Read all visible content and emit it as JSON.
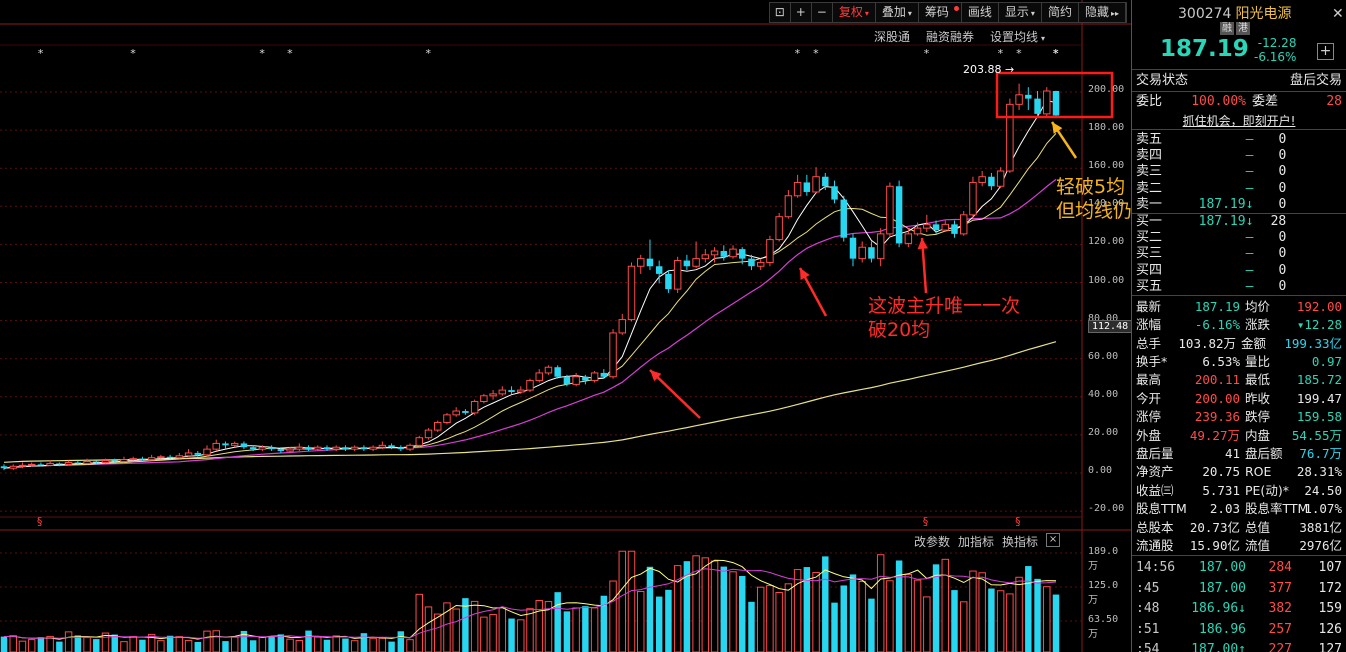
{
  "toolbar": {
    "fuquan": "复权",
    "diejia": "叠加",
    "chouma": "筹码",
    "huaxian": "画线",
    "xianshi": "显示",
    "jianyue": "简约",
    "yincang": "隐藏"
  },
  "subbar": {
    "shengutong": "深股通",
    "rongzi": "融资融券",
    "junxian": "设置均线"
  },
  "y_axis_ticks": [
    "200.00",
    "180.00",
    "160.00",
    "140.00",
    "120.00",
    "100.00",
    "80.00",
    "60.00",
    "40.00",
    "20.00",
    "0.00",
    "-20.00"
  ],
  "current_price_tag": "112.48",
  "peak_label": "203.88",
  "vol_axis_ticks": [
    "189.0万",
    "125.0万",
    "63.50万"
  ],
  "vol_toolbar": {
    "gaicanshu": "改参数",
    "jiazhibiao": "加指标",
    "huanzhibiao": "换指标",
    "close": "×"
  },
  "annotations": {
    "five_ma_line1": "轻破5均",
    "five_ma_line2": "但均线仍发散",
    "twenty_ma_line1": "这波主升唯一一次",
    "twenty_ma_line2": "破20均"
  },
  "colors": {
    "up": "#ff4b4b",
    "down": "#29d6f0",
    "ma5": "#ffffff",
    "ma10": "#e8e07a",
    "ma20": "#d43fd4",
    "ma60": "#e6e08a",
    "annotation_red": "#ff2a2a",
    "annotation_gold": "#f5b41a"
  },
  "chart_data": {
    "type": "candlestick",
    "title": "",
    "xlabel": "",
    "ylabel": "",
    "ylim": [
      -20,
      210
    ],
    "grid": true,
    "peak": 203.88,
    "candles": [
      {
        "o": 3,
        "c": 2,
        "h": 4,
        "l": 1
      },
      {
        "o": 2,
        "c": 3,
        "h": 4,
        "l": 1
      },
      {
        "o": 3,
        "c": 3.5,
        "h": 5,
        "l": 2
      },
      {
        "o": 3.5,
        "c": 4,
        "h": 5,
        "l": 3
      },
      {
        "o": 4,
        "c": 3.5,
        "h": 5,
        "l": 3
      },
      {
        "o": 3.5,
        "c": 4.5,
        "h": 6,
        "l": 3
      },
      {
        "o": 4.5,
        "c": 4,
        "h": 5,
        "l": 3
      },
      {
        "o": 4,
        "c": 5,
        "h": 6,
        "l": 3.5
      },
      {
        "o": 5,
        "c": 4.5,
        "h": 6,
        "l": 4
      },
      {
        "o": 4.5,
        "c": 5.5,
        "h": 7,
        "l": 4
      },
      {
        "o": 5.5,
        "c": 5,
        "h": 6,
        "l": 4
      },
      {
        "o": 5,
        "c": 6,
        "h": 7,
        "l": 4.5
      },
      {
        "o": 6,
        "c": 5.5,
        "h": 7,
        "l": 5
      },
      {
        "o": 5.5,
        "c": 6.5,
        "h": 8,
        "l": 5
      },
      {
        "o": 6.5,
        "c": 7,
        "h": 8,
        "l": 6
      },
      {
        "o": 7,
        "c": 6.5,
        "h": 8,
        "l": 6
      },
      {
        "o": 6.5,
        "c": 7.5,
        "h": 9,
        "l": 6
      },
      {
        "o": 7.5,
        "c": 8,
        "h": 9,
        "l": 7
      },
      {
        "o": 8,
        "c": 7.5,
        "h": 9,
        "l": 7
      },
      {
        "o": 7.5,
        "c": 8.5,
        "h": 10,
        "l": 7
      },
      {
        "o": 8.5,
        "c": 10,
        "h": 12,
        "l": 8
      },
      {
        "o": 10,
        "c": 9,
        "h": 11,
        "l": 8
      },
      {
        "o": 9,
        "c": 12,
        "h": 14,
        "l": 8
      },
      {
        "o": 12,
        "c": 15,
        "h": 17,
        "l": 11
      },
      {
        "o": 15,
        "c": 14,
        "h": 16,
        "l": 12
      },
      {
        "o": 14,
        "c": 15,
        "h": 16,
        "l": 13
      },
      {
        "o": 15,
        "c": 13,
        "h": 16,
        "l": 12
      },
      {
        "o": 13,
        "c": 12,
        "h": 14,
        "l": 11
      },
      {
        "o": 12,
        "c": 13,
        "h": 14,
        "l": 11
      },
      {
        "o": 13,
        "c": 12,
        "h": 14,
        "l": 11
      },
      {
        "o": 12,
        "c": 11,
        "h": 13,
        "l": 10
      },
      {
        "o": 11,
        "c": 12,
        "h": 13,
        "l": 10
      },
      {
        "o": 12,
        "c": 13,
        "h": 15,
        "l": 11
      },
      {
        "o": 13,
        "c": 12,
        "h": 14,
        "l": 11
      },
      {
        "o": 12,
        "c": 13,
        "h": 14,
        "l": 11
      },
      {
        "o": 13,
        "c": 12,
        "h": 14,
        "l": 11
      },
      {
        "o": 12,
        "c": 13,
        "h": 14,
        "l": 11
      },
      {
        "o": 13,
        "c": 12,
        "h": 14,
        "l": 11
      },
      {
        "o": 12,
        "c": 13,
        "h": 14,
        "l": 11
      },
      {
        "o": 13,
        "c": 12,
        "h": 14,
        "l": 11
      },
      {
        "o": 12,
        "c": 13,
        "h": 14,
        "l": 11
      },
      {
        "o": 13,
        "c": 14,
        "h": 16,
        "l": 12
      },
      {
        "o": 14,
        "c": 13,
        "h": 15,
        "l": 12
      },
      {
        "o": 13,
        "c": 12,
        "h": 14,
        "l": 11
      },
      {
        "o": 12,
        "c": 14,
        "h": 15,
        "l": 11
      },
      {
        "o": 14,
        "c": 18,
        "h": 19,
        "l": 13
      },
      {
        "o": 18,
        "c": 22,
        "h": 23,
        "l": 17
      },
      {
        "o": 22,
        "c": 26,
        "h": 27,
        "l": 21
      },
      {
        "o": 26,
        "c": 30,
        "h": 31,
        "l": 25
      },
      {
        "o": 30,
        "c": 32,
        "h": 34,
        "l": 29
      },
      {
        "o": 32,
        "c": 31,
        "h": 33,
        "l": 30
      },
      {
        "o": 31,
        "c": 37,
        "h": 38,
        "l": 30
      },
      {
        "o": 37,
        "c": 40,
        "h": 41,
        "l": 36
      },
      {
        "o": 40,
        "c": 41,
        "h": 43,
        "l": 38
      },
      {
        "o": 41,
        "c": 43,
        "h": 45,
        "l": 40
      },
      {
        "o": 43,
        "c": 42,
        "h": 45,
        "l": 41
      },
      {
        "o": 42,
        "c": 43,
        "h": 45,
        "l": 41
      },
      {
        "o": 43,
        "c": 48,
        "h": 49,
        "l": 42
      },
      {
        "o": 48,
        "c": 52,
        "h": 54,
        "l": 47
      },
      {
        "o": 52,
        "c": 55,
        "h": 56,
        "l": 51
      },
      {
        "o": 55,
        "c": 50,
        "h": 56,
        "l": 49
      },
      {
        "o": 50,
        "c": 46,
        "h": 51,
        "l": 45
      },
      {
        "o": 46,
        "c": 50,
        "h": 52,
        "l": 45
      },
      {
        "o": 50,
        "c": 48,
        "h": 51,
        "l": 46
      },
      {
        "o": 48,
        "c": 52,
        "h": 53,
        "l": 47
      },
      {
        "o": 52,
        "c": 50,
        "h": 54,
        "l": 49
      },
      {
        "o": 50,
        "c": 73,
        "h": 75,
        "l": 49
      },
      {
        "o": 73,
        "c": 80,
        "h": 83,
        "l": 72
      },
      {
        "o": 80,
        "c": 108,
        "h": 110,
        "l": 79
      },
      {
        "o": 108,
        "c": 112,
        "h": 114,
        "l": 104
      },
      {
        "o": 112,
        "c": 108,
        "h": 122,
        "l": 106
      },
      {
        "o": 108,
        "c": 104,
        "h": 111,
        "l": 99
      },
      {
        "o": 104,
        "c": 96,
        "h": 106,
        "l": 94
      },
      {
        "o": 96,
        "c": 111,
        "h": 113,
        "l": 94
      },
      {
        "o": 111,
        "c": 108,
        "h": 114,
        "l": 106
      },
      {
        "o": 108,
        "c": 112,
        "h": 121,
        "l": 107
      },
      {
        "o": 112,
        "c": 114,
        "h": 117,
        "l": 110
      },
      {
        "o": 114,
        "c": 116,
        "h": 118,
        "l": 110
      },
      {
        "o": 116,
        "c": 113,
        "h": 119,
        "l": 111
      },
      {
        "o": 113,
        "c": 117,
        "h": 119,
        "l": 112
      },
      {
        "o": 117,
        "c": 112,
        "h": 118,
        "l": 109
      },
      {
        "o": 112,
        "c": 108,
        "h": 114,
        "l": 106
      },
      {
        "o": 108,
        "c": 110,
        "h": 112,
        "l": 106
      },
      {
        "o": 110,
        "c": 122,
        "h": 124,
        "l": 108
      },
      {
        "o": 122,
        "c": 134,
        "h": 136,
        "l": 121
      },
      {
        "o": 134,
        "c": 145,
        "h": 148,
        "l": 133
      },
      {
        "o": 145,
        "c": 152,
        "h": 156,
        "l": 144
      },
      {
        "o": 152,
        "c": 147,
        "h": 156,
        "l": 145
      },
      {
        "o": 147,
        "c": 155,
        "h": 160,
        "l": 146
      },
      {
        "o": 155,
        "c": 150,
        "h": 157,
        "l": 148
      },
      {
        "o": 150,
        "c": 143,
        "h": 153,
        "l": 141
      },
      {
        "o": 143,
        "c": 123,
        "h": 145,
        "l": 121
      },
      {
        "o": 123,
        "c": 112,
        "h": 125,
        "l": 108
      },
      {
        "o": 112,
        "c": 118,
        "h": 121,
        "l": 110
      },
      {
        "o": 118,
        "c": 112,
        "h": 121,
        "l": 110
      },
      {
        "o": 112,
        "c": 125,
        "h": 128,
        "l": 108
      },
      {
        "o": 125,
        "c": 150,
        "h": 152,
        "l": 123
      },
      {
        "o": 150,
        "c": 120,
        "h": 153,
        "l": 118
      },
      {
        "o": 120,
        "c": 125,
        "h": 128,
        "l": 118
      },
      {
        "o": 125,
        "c": 128,
        "h": 131,
        "l": 124
      },
      {
        "o": 128,
        "c": 130,
        "h": 135,
        "l": 126
      },
      {
        "o": 130,
        "c": 127,
        "h": 132,
        "l": 125
      },
      {
        "o": 127,
        "c": 130,
        "h": 132,
        "l": 126
      },
      {
        "o": 130,
        "c": 125,
        "h": 132,
        "l": 123
      },
      {
        "o": 125,
        "c": 135,
        "h": 137,
        "l": 124
      },
      {
        "o": 135,
        "c": 152,
        "h": 155,
        "l": 133
      },
      {
        "o": 152,
        "c": 155,
        "h": 158,
        "l": 150
      },
      {
        "o": 155,
        "c": 150,
        "h": 157,
        "l": 148
      },
      {
        "o": 150,
        "c": 158,
        "h": 160,
        "l": 149
      },
      {
        "o": 158,
        "c": 193,
        "h": 196,
        "l": 157
      },
      {
        "o": 193,
        "c": 198,
        "h": 203.88,
        "l": 190
      },
      {
        "o": 198,
        "c": 196,
        "h": 202,
        "l": 190
      },
      {
        "o": 196,
        "c": 188,
        "h": 200,
        "l": 186
      },
      {
        "o": 188,
        "c": 200,
        "h": 202,
        "l": 186
      },
      {
        "o": 200,
        "c": 187.19,
        "h": 200.11,
        "l": 185.72
      }
    ],
    "volume_ylim": [
      0,
      200
    ],
    "volume_unit": "万"
  },
  "right_panel": {
    "code": "300274",
    "name": "阳光电源",
    "tags": [
      "融",
      "港"
    ],
    "price": "187.19",
    "change": "-12.28",
    "change_pct": "-6.16%",
    "status_label": "交易状态",
    "status_value": "盘后交易",
    "weibi_label": "委比",
    "weibi_value": "100.00%",
    "weicha_label": "委差",
    "weicha_value": "28",
    "ad": "抓住机会，即刻开户!",
    "asks": [
      {
        "label": "卖五",
        "price": "—",
        "vol": "0",
        "chg": ""
      },
      {
        "label": "卖四",
        "price": "—",
        "vol": "0",
        "chg": ""
      },
      {
        "label": "卖三",
        "price": "—",
        "vol": "0",
        "chg": ""
      },
      {
        "label": "卖二",
        "price": "—",
        "vol": "0",
        "chg": ""
      },
      {
        "label": "卖一",
        "price": "187.19↓",
        "vol": "0",
        "chg": ""
      }
    ],
    "bids": [
      {
        "label": "买一",
        "price": "187.19↓",
        "vol": "28",
        "chg": ""
      },
      {
        "label": "买二",
        "price": "—",
        "vol": "0",
        "chg": ""
      },
      {
        "label": "买三",
        "price": "—",
        "vol": "0",
        "chg": ""
      },
      {
        "label": "买四",
        "price": "—",
        "vol": "0",
        "chg": ""
      },
      {
        "label": "买五",
        "price": "—",
        "vol": "0",
        "chg": ""
      }
    ],
    "stats": [
      {
        "l1": "最新",
        "v1": "187.19",
        "c1": "green",
        "l2": "均价",
        "v2": "192.00",
        "c2": "red"
      },
      {
        "l1": "涨幅",
        "v1": "-6.16%",
        "c1": "green",
        "l2": "涨跌",
        "v2": "▾12.28",
        "c2": "green"
      },
      {
        "l1": "总手",
        "v1": "103.82万",
        "c1": "white",
        "l2": "金额",
        "v2": "199.33亿",
        "c2": "cyan"
      },
      {
        "l1": "换手*",
        "v1": "6.53%",
        "c1": "white",
        "l2": "量比",
        "v2": "0.97",
        "c2": "green"
      },
      {
        "l1": "最高",
        "v1": "200.11",
        "c1": "red",
        "l2": "最低",
        "v2": "185.72",
        "c2": "green"
      },
      {
        "l1": "今开",
        "v1": "200.00",
        "c1": "red",
        "l2": "昨收",
        "v2": "199.47",
        "c2": "white"
      },
      {
        "l1": "涨停",
        "v1": "239.36",
        "c1": "red",
        "l2": "跌停",
        "v2": "159.58",
        "c2": "green"
      },
      {
        "l1": "外盘",
        "v1": "49.27万",
        "c1": "red",
        "l2": "内盘",
        "v2": "54.55万",
        "c2": "green"
      },
      {
        "l1": "盘后量",
        "v1": "41",
        "c1": "white",
        "l2": "盘后额",
        "v2": "76.7万",
        "c2": "cyan"
      },
      {
        "l1": "净资产",
        "v1": "20.75",
        "c1": "white",
        "l2": "ROE",
        "v2": "28.31%",
        "c2": "white"
      },
      {
        "l1": "收益㈢",
        "v1": "5.731",
        "c1": "white",
        "l2": "PE(动)*",
        "v2": "24.50",
        "c2": "white"
      },
      {
        "l1": "股息TTM",
        "v1": "2.03",
        "c1": "white",
        "l2": "股息率TTM",
        "v2": "1.07%",
        "c2": "white"
      },
      {
        "l1": "总股本",
        "v1": "20.73亿",
        "c1": "white",
        "l2": "总值",
        "v2": "3881亿",
        "c2": "white"
      },
      {
        "l1": "流通股",
        "v1": "15.90亿",
        "c1": "white",
        "l2": "流值",
        "v2": "2976亿",
        "c2": "white"
      }
    ],
    "trades": [
      {
        "t": "14:56",
        "p": "187.00",
        "pc": "green",
        "v": "284",
        "vc": "red",
        "n": "107"
      },
      {
        "t": ":45",
        "p": "187.00",
        "pc": "green",
        "v": "377",
        "vc": "red",
        "n": "172"
      },
      {
        "t": ":48",
        "p": "186.96↓",
        "pc": "green",
        "v": "382",
        "vc": "red",
        "n": "159"
      },
      {
        "t": ":51",
        "p": "186.96",
        "pc": "green",
        "v": "257",
        "vc": "red",
        "n": "126"
      },
      {
        "t": ":54",
        "p": "187.00↑",
        "pc": "green",
        "v": "227",
        "vc": "red",
        "n": "127"
      }
    ]
  }
}
